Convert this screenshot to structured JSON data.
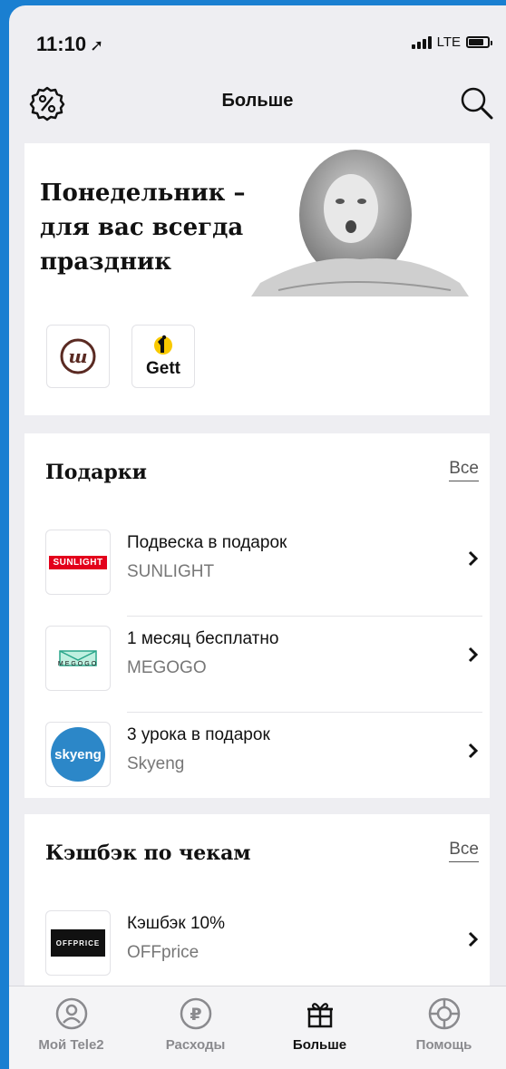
{
  "status": {
    "time": "11:10",
    "network": "LTE"
  },
  "header": {
    "title": "Больше"
  },
  "promo": {
    "headline": "Понедельник – для вас всегда праздник",
    "partners": [
      {
        "name": "ш-logo",
        "label": ""
      },
      {
        "name": "gett",
        "label": "Gett"
      }
    ]
  },
  "gifts": {
    "title": "Подарки",
    "all_label": "Все",
    "items": [
      {
        "title": "Подвеска в подарок",
        "brand": "SUNLIGHT",
        "logo_text": "SUNLIGHT"
      },
      {
        "title": "1 месяц бесплатно",
        "brand": "MEGOGO",
        "logo_text": "MEGOGO"
      },
      {
        "title": "3 урока в подарок",
        "brand": "Skyeng",
        "logo_text": "skyeng"
      }
    ]
  },
  "cashback": {
    "title": "Кэшбэк по чекам",
    "all_label": "Все",
    "items": [
      {
        "title": "Кэшбэк 10%",
        "brand": "OFFprice",
        "logo_text": "OFFPRICE"
      }
    ]
  },
  "tabbar": {
    "tabs": [
      {
        "label": "Мой Tele2",
        "icon": "user-icon"
      },
      {
        "label": "Расходы",
        "icon": "ruble-icon"
      },
      {
        "label": "Больше",
        "icon": "gift-icon",
        "active": true
      },
      {
        "label": "Помощь",
        "icon": "lifebuoy-icon"
      }
    ]
  },
  "colors": {
    "background": "#eeeef2",
    "accent": "#111111",
    "inactive": "#8a8a8e",
    "sunlight": "#e3001b",
    "skyeng": "#2c87c8"
  }
}
